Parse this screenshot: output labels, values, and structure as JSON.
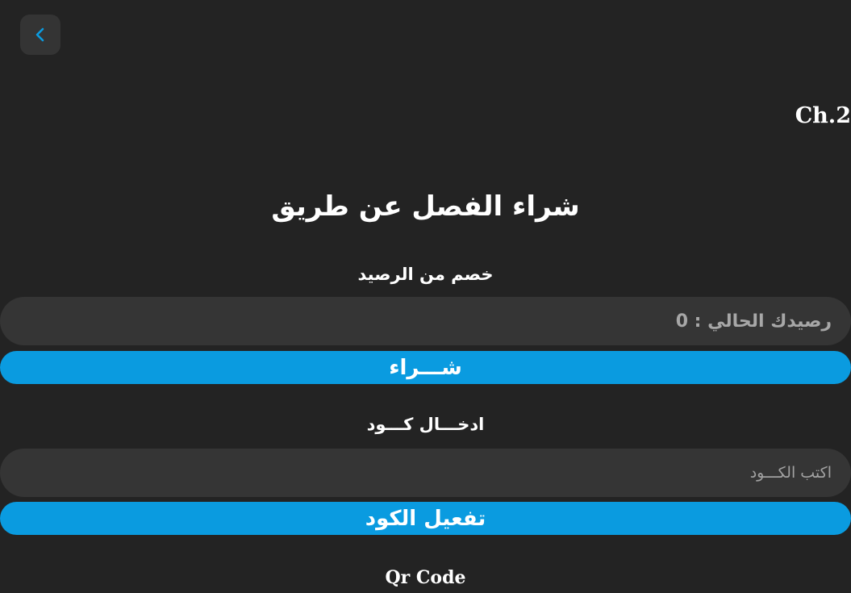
{
  "header": {
    "back_icon": "chevron-left-icon",
    "back_icon_color": "#0a9be0",
    "chapter": "Ch.2"
  },
  "purchase": {
    "title": "شراء الفصل عن طريق",
    "balance_section": {
      "label": "خصم من الرصيد",
      "balance_text": "رصيدك الحالي : 0",
      "button_label": "شـــراء"
    },
    "code_section": {
      "label": "ادخـــال كـــود",
      "placeholder": "اكتب الكـــود",
      "value": "",
      "button_label": "تفعيل الكود"
    },
    "qr_label": "Qr Code"
  },
  "colors": {
    "background": "#232323",
    "field_background": "#353535",
    "accent": "#0a9be0"
  }
}
